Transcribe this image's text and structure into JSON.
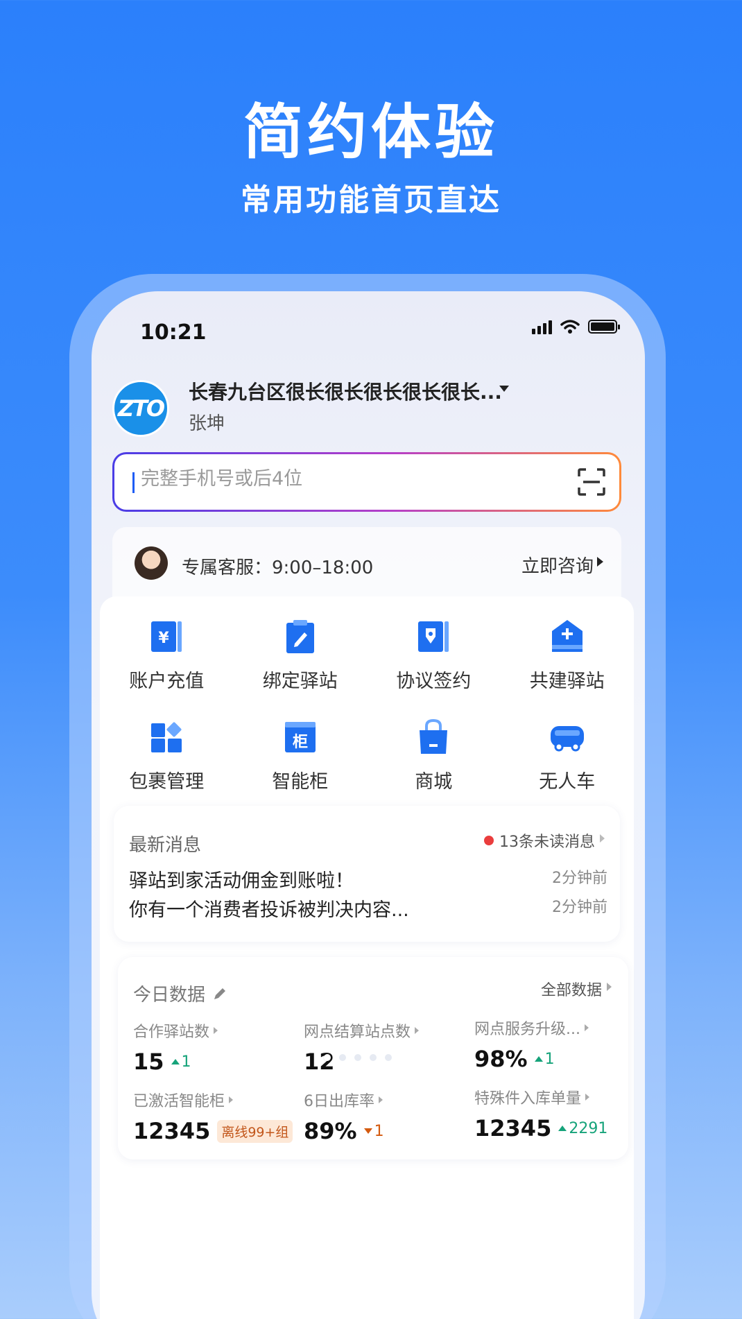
{
  "hero": {
    "title": "简约体验",
    "subtitle": "常用功能首页直达"
  },
  "status_bar": {
    "time": "10:21"
  },
  "header": {
    "logo_text": "ZTO",
    "station_name": "长春九台区很长很长很长很长很长...",
    "user_name": "张坤"
  },
  "search": {
    "placeholder": "完整手机号或后4位"
  },
  "service": {
    "text": "专属客服：9:00–18:00",
    "consult_label": "立即咨询"
  },
  "functions": [
    {
      "label": "账户充值",
      "icon": "yuan-card-icon"
    },
    {
      "label": "绑定驿站",
      "icon": "clipboard-pen-icon"
    },
    {
      "label": "协议签约",
      "icon": "contract-pen-icon"
    },
    {
      "label": "共建驿站",
      "icon": "house-plus-icon"
    },
    {
      "label": "包裹管理",
      "icon": "blocks-icon"
    },
    {
      "label": "智能柜",
      "icon": "cabinet-icon"
    },
    {
      "label": "商城",
      "icon": "shopping-bag-icon"
    },
    {
      "label": "无人车",
      "icon": "vehicle-icon"
    }
  ],
  "messages": {
    "title": "最新消息",
    "unread": "13条未读消息",
    "items": [
      {
        "text": "驿站到家活动佣金到账啦！",
        "time": "2分钟前"
      },
      {
        "text": "你有一个消费者投诉被判决内容...",
        "time": "2分钟前"
      }
    ]
  },
  "today_data": {
    "title": "今日数据",
    "all_label": "全部数据",
    "stats": [
      {
        "label": "合作驿站数",
        "value": "15",
        "delta": "1",
        "trend": "up"
      },
      {
        "label": "网点结算站点数",
        "value": "12",
        "delta": "",
        "trend": ""
      },
      {
        "label": "网点服务升级...",
        "value": "98%",
        "delta": "1",
        "trend": "up"
      },
      {
        "label": "已激活智能柜",
        "value": "12345",
        "badge": "离线99+组"
      },
      {
        "label": "6日出库率",
        "value": "89%",
        "delta": "1",
        "trend": "down"
      },
      {
        "label": "特殊件入库单量",
        "value": "12345",
        "delta": "2291",
        "trend": "up"
      }
    ]
  },
  "colors": {
    "brand_blue": "#2b80fb",
    "icon_blue": "#1e6ff0",
    "up_green": "#16a37a",
    "down_orange": "#d45a0f"
  }
}
